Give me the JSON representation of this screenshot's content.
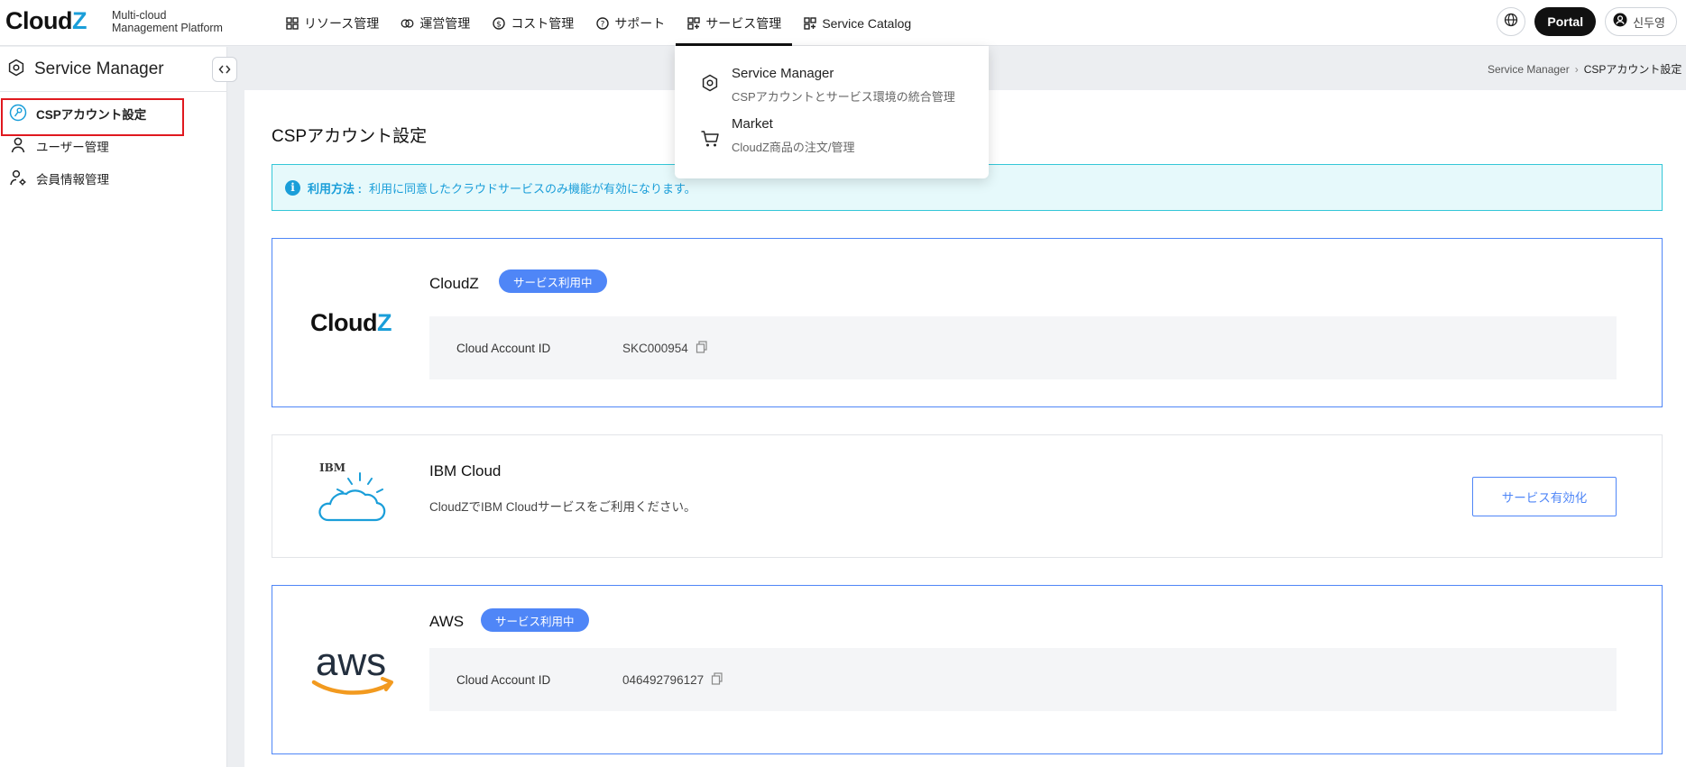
{
  "header": {
    "logo_main": "Cloud",
    "logo_z": "Z",
    "tagline_line1": "Multi-cloud",
    "tagline_line2": "Management Platform",
    "nav": [
      {
        "label": "リソース管理",
        "icon": "grid-icon"
      },
      {
        "label": "運営管理",
        "icon": "link-rings-icon"
      },
      {
        "label": "コスト管理",
        "icon": "dollar-circle-icon"
      },
      {
        "label": "サポート",
        "icon": "help-circle-icon"
      },
      {
        "label": "サービス管理",
        "icon": "grid-plus-icon"
      },
      {
        "label": "Service Catalog",
        "icon": "grid-plus-icon"
      }
    ],
    "portal_label": "Portal",
    "user_name": "신두영"
  },
  "dropdown": {
    "items": [
      {
        "title": "Service Manager",
        "subtitle": "CSPアカウントとサービス環境の統合管理",
        "icon": "hexagon-gear-icon"
      },
      {
        "title": "Market",
        "subtitle": "CloudZ商品の注文/管理",
        "icon": "cart-icon"
      }
    ]
  },
  "sidebar": {
    "title": "Service Manager",
    "items": [
      {
        "label": "CSPアカウント設定",
        "icon": "key-circle-icon"
      },
      {
        "label": "ユーザー管理",
        "icon": "person-icon"
      },
      {
        "label": "会員情報管理",
        "icon": "person-gear-icon"
      }
    ]
  },
  "breadcrumb": {
    "root": "Service Manager",
    "current": "CSPアカウント設定"
  },
  "main": {
    "title": "CSPアカウント設定",
    "info_label": "利用方法 :",
    "info_text": "利用に同意したクラウドサービスのみ機能が有効になります。",
    "cards": [
      {
        "name": "CloudZ",
        "badge": "サービス利用中",
        "account_label": "Cloud Account ID",
        "account_id": "SKC000954"
      },
      {
        "name": "IBM Cloud",
        "description": "CloudZでIBM Cloudサービスをご利用ください。",
        "button": "サービス有効化",
        "logo_text": "IBM"
      },
      {
        "name": "AWS",
        "badge": "サービス利用中",
        "account_label": "Cloud Account ID",
        "account_id": "046492796127",
        "logo_text": "aws"
      }
    ]
  },
  "colors": {
    "accent_blue": "#4f86f7",
    "info_cyan": "#1a9ed9",
    "highlight_red": "#e0191f"
  }
}
